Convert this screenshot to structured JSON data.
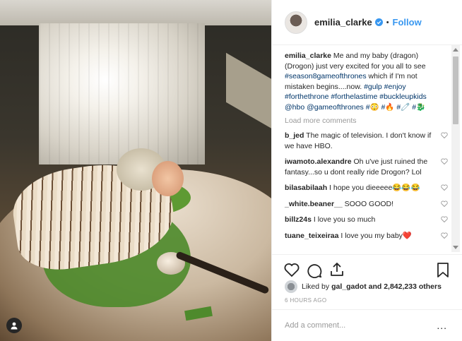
{
  "post": {
    "username": "emilia_clarke",
    "follow_label": "Follow",
    "dot": "•"
  },
  "caption": {
    "username": "emilia_clarke",
    "text_1": " Me and my baby (dragon) (Drogon) just very excited for you all to see ",
    "tag_1": "#season8gameofthrones",
    "text_2": " which if I'm not mistaken begins....now. ",
    "tag_2": "#gulp #enjoy #forthethrone #forthelastime #buckleupkids @hbo @gameofthrones",
    "tail": " #😳 #🔥 #🧷 #🐉"
  },
  "load_more": "Load more comments",
  "comments": [
    {
      "user": "b_jed",
      "text": " The magic of television. I don't know if we have HBO."
    },
    {
      "user": "iwamoto.alexandre",
      "text": " Oh u've just ruined the fantasy...so u dont really ride Drogon? Lol"
    },
    {
      "user": "bilasabilaah",
      "text": " I hope you dieeeee😂😂😂"
    },
    {
      "user": "_white.beaner__",
      "text": " SOOO GOOD!"
    },
    {
      "user": "billz24s",
      "text": " I love you so much"
    },
    {
      "user": "tuane_teixeiraa",
      "text": " I love you my baby❤️"
    }
  ],
  "likes": {
    "prefix": "Liked by ",
    "user": "gal_gadot",
    "suffix": " and 2,842,233 others"
  },
  "timestamp": "6 HOURS AGO",
  "add_comment": {
    "placeholder": "Add a comment..."
  },
  "more_label": "...",
  "colors": {
    "accent": "#3897f0",
    "text": "#262626",
    "muted": "#999999",
    "border": "#efefef"
  },
  "icons": [
    "verified-icon",
    "heart-icon",
    "comment-icon",
    "share-icon",
    "bookmark-icon",
    "user-tag-icon",
    "more-icon"
  ]
}
